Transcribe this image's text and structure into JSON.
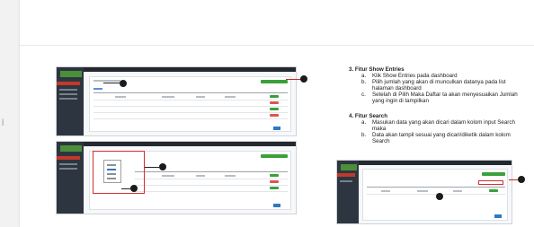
{
  "document": {
    "edge_mark": "l",
    "section1": {
      "heading": "3. Fitur Show Entries",
      "items": [
        {
          "marker": "a.",
          "text": "Klik Show Entries pada dashboard"
        },
        {
          "marker": "b.",
          "text": "Pilih jumlah yang akan di munculkan datanya pada list halaman dashboard"
        },
        {
          "marker": "c.",
          "text": "Setelah di Pilih Maka Daftar ta akan menyesuaikan Jumlah yang ingin di tampilkan"
        }
      ]
    },
    "section2": {
      "heading": "4. Fitur Search",
      "items": [
        {
          "marker": "a.",
          "text": "Masukan data yang akan dicari dalam kolom input Search maka"
        },
        {
          "marker": "b.",
          "text": "Data akan tampil sesuai yang dicari/diketik dalam kolom Search"
        }
      ]
    },
    "colors": {
      "callout": "#1b1b1b",
      "highlight": "#d32f2f",
      "sidebar": "#2d3640",
      "accent_green": "#3aa03a"
    }
  }
}
